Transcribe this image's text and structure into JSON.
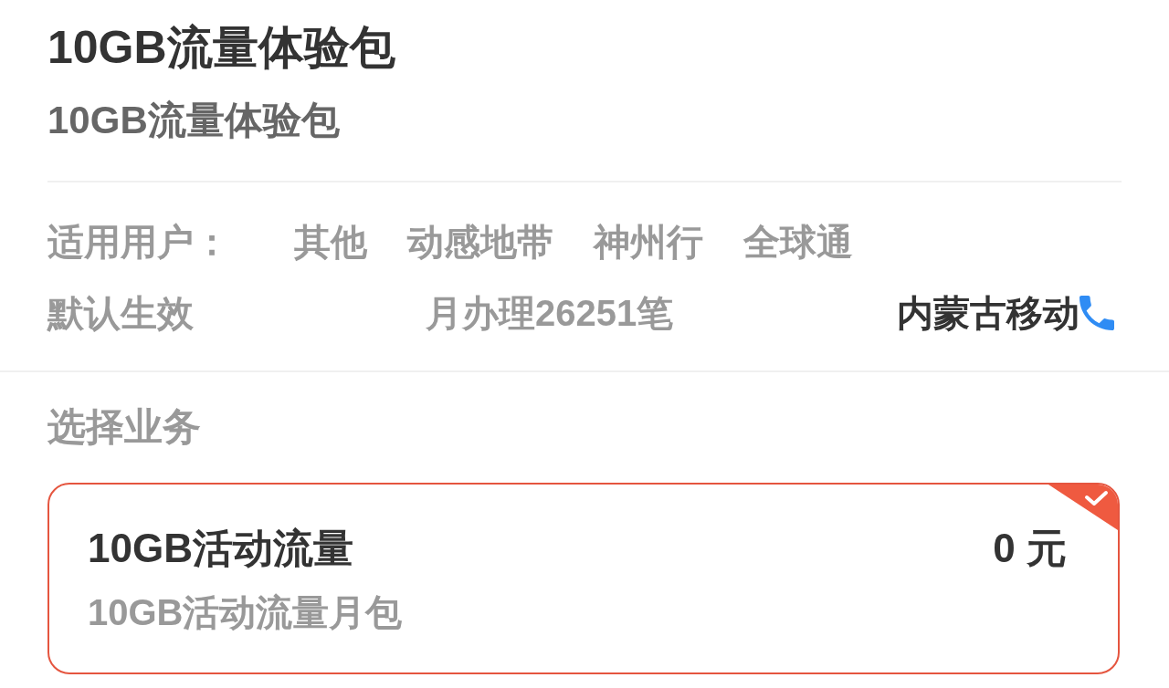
{
  "package": {
    "title": "10GB流量体验包",
    "subtitle": "10GB流量体验包"
  },
  "info": {
    "users_label": "适用用户：",
    "user_types": [
      "其他",
      "动感地带",
      "神州行",
      "全球通"
    ],
    "effect": "默认生效",
    "monthly_count": "月办理26251笔",
    "provider": "内蒙古移动"
  },
  "section_title": "选择业务",
  "options": [
    {
      "name": "10GB活动流量",
      "price": "0 元",
      "description": "10GB活动流量月包",
      "selected": true
    }
  ]
}
